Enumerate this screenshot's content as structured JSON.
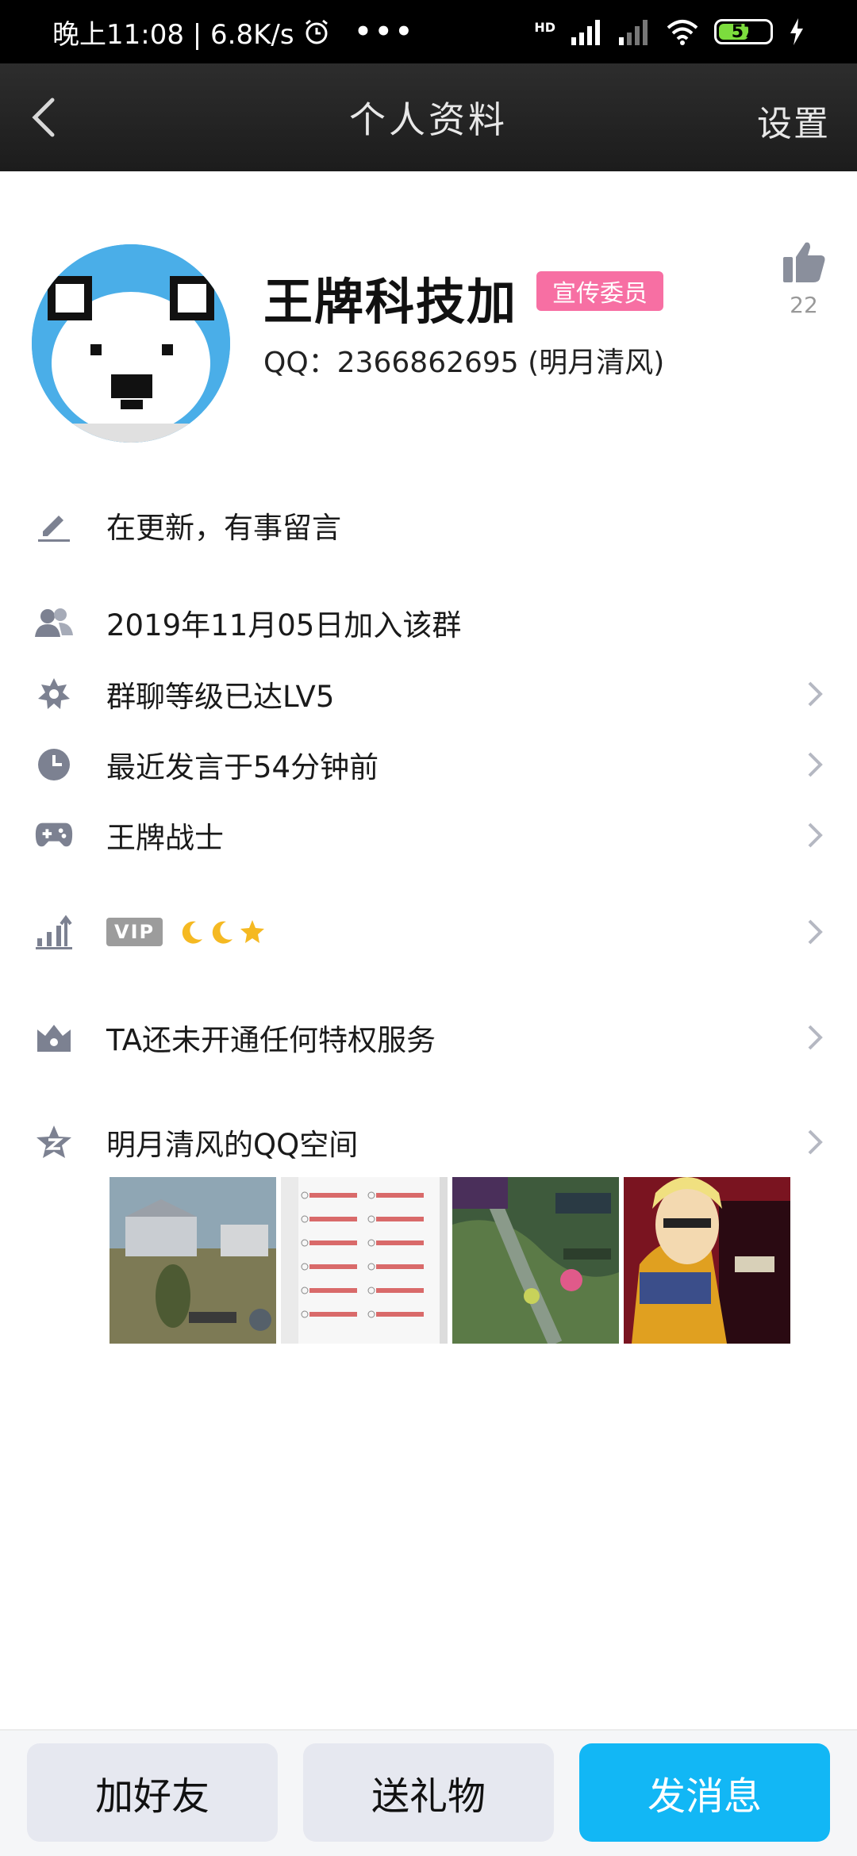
{
  "status_bar": {
    "time_speed": "晚上11:08 | 6.8K/s",
    "network": "HD",
    "battery": "57"
  },
  "nav": {
    "title": "个人资料",
    "settings": "设置"
  },
  "profile": {
    "name": "王牌科技加",
    "badge": "宣传委员",
    "qq_line": "QQ：2366862695 (明月清风)",
    "like_count": "22"
  },
  "rows": {
    "signature": "在更新，有事留言",
    "joined": "2019年11月05日加入该群",
    "level": "群聊等级已达LV5",
    "last_spoke": "最近发言于54分钟前",
    "game": "王牌战士",
    "vip_label": "VIP",
    "privilege": "TA还未开通任何特权服务",
    "qzone": "明月清风的QQ空间"
  },
  "photos": [
    "game-screenshot-1",
    "settings-list-screenshot",
    "moba-game-screenshot",
    "anime-character-screenshot"
  ],
  "bottom": {
    "add_friend": "加好友",
    "send_gift": "送礼物",
    "send_message": "发消息"
  },
  "colors": {
    "badge": "#f76fa3",
    "primary": "#12b7f5",
    "nav_bg": "#222222",
    "icon": "#7c8191"
  }
}
